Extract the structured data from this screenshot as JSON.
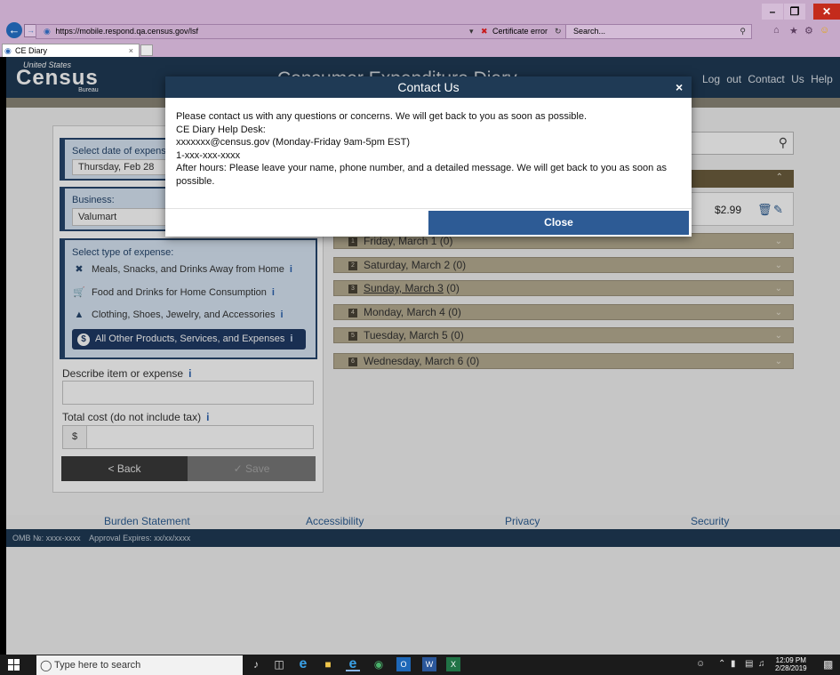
{
  "browser": {
    "url": "https://mobile.respond.qa.census.gov/lsf",
    "cert_error": "Certificate error",
    "search_placeholder": "Search...",
    "tab_title": "CE Diary"
  },
  "header": {
    "logo_top": "United States",
    "logo_main": "Census",
    "logo_sub": "Bureau",
    "title": "Consumer Expenditure Diary",
    "nav": [
      "Log out",
      "Contact Us",
      "Help"
    ]
  },
  "form": {
    "date_label": "Select date of expense",
    "date_value": "Thursday, Feb 28",
    "business_label": "Business:",
    "business_value": "Valumart",
    "type_label": "Select type of expense:",
    "categories": [
      {
        "label": "Meals, Snacks, and Drinks Away from Home",
        "icon": "utensils-icon"
      },
      {
        "label": "Food and Drinks for Home Consumption",
        "icon": "cart-icon"
      },
      {
        "label": "Clothing, Shoes, Jewelry, and Accessories",
        "icon": "shirt-icon"
      },
      {
        "label": "All Other Products, Services, and Expenses",
        "icon": "dollar-icon",
        "selected": true
      }
    ],
    "describe_label": "Describe item or expense",
    "cost_label": "Total cost (do not include tax)",
    "currency": "$",
    "back_label": "< Back",
    "save_label": "✓ Save"
  },
  "expense_item": {
    "amount": "$2.99"
  },
  "days": [
    {
      "label": "Friday, March 1 (0)",
      "num": "1"
    },
    {
      "label": "Saturday, March 2 (0)",
      "num": "2"
    },
    {
      "label_day": "Sunday, March 3",
      "label_count": " (0)",
      "num": "3"
    },
    {
      "label": "Monday, March 4 (0)",
      "num": "4"
    },
    {
      "label": "Tuesday, March 5 (0)",
      "num": "5"
    },
    {
      "label": "Wednesday, March 6 (0)",
      "num": "6"
    }
  ],
  "footer": {
    "links": [
      "Burden Statement",
      "Accessibility",
      "Privacy",
      "Security"
    ],
    "omb": "OMB №: xxxx-xxxx    Approval Expires: xx/xx/xxxx"
  },
  "modal": {
    "title": "Contact Us",
    "lines": [
      "Please contact us with any questions or concerns. We will get back to you as soon as possible.",
      "CE Diary Help Desk:",
      "xxxxxxx@census.gov (Monday-Friday 9am-5pm EST)",
      "1-xxx-xxx-xxxx",
      "After hours: Please leave your name, phone number, and a detailed message. We will get back to you as soon as possible."
    ],
    "close_label": "Close"
  },
  "taskbar": {
    "search_placeholder": "Type here to search",
    "time": "12:09 PM",
    "date": "2/28/2019"
  }
}
